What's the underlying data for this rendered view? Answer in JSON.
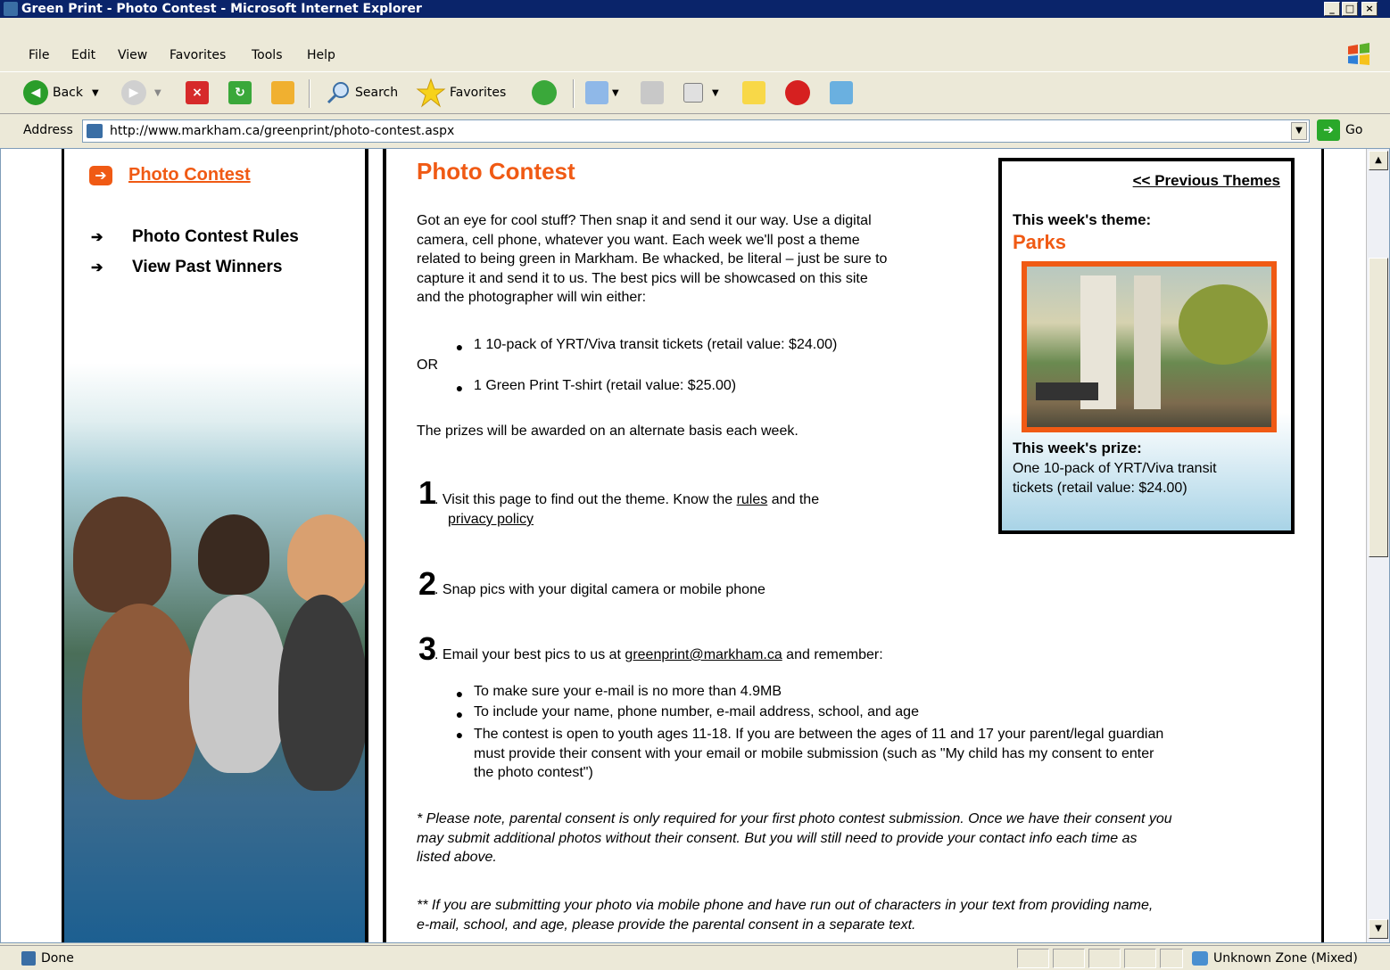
{
  "window": {
    "title": "Green Print - Photo Contest - Microsoft Internet Explorer"
  },
  "menu": [
    "File",
    "Edit",
    "View",
    "Favorites",
    "Tools",
    "Help"
  ],
  "toolbar": {
    "back": "Back",
    "search": "Search",
    "favorites": "Favorites"
  },
  "address": {
    "label": "Address",
    "url": "http://www.markham.ca/greenprint/photo-contest.aspx",
    "go": "Go"
  },
  "nav": {
    "current": "Photo Contest",
    "items": [
      "Photo Contest Rules",
      "View Past Winners"
    ]
  },
  "main": {
    "title": "Photo Contest",
    "intro_lines": [
      "Got an eye for cool stuff? Then snap it and send it our way. Use a digital",
      "camera, cell phone, whatever you want. Each week we'll post a theme",
      "related to being green in Markham. Be whacked, be literal – just be sure to",
      "capture it and send it to us. The best pics will be showcased on this site",
      "and the photographer will win either:"
    ],
    "prize_option_1": "1 10-pack of YRT/Viva transit tickets (retail value: $24.00)",
    "or_text": "OR",
    "prize_option_2": "1 Green Print T-shirt (retail value: $25.00)",
    "alternate_note": "The prizes will be awarded on an alternate basis each week.",
    "step1": {
      "num": "1",
      "text_before": ". Visit this page to find out the theme. Know the ",
      "rules_link": "rules",
      "text_after": " and the",
      "privacy_link": "privacy policy"
    },
    "step2": {
      "num": "2",
      "text": ". Snap pics with your digital camera or mobile phone"
    },
    "step3": {
      "num": "3",
      "text_before": ". Email your best pics to us at ",
      "email_link": "greenprint@markham.ca",
      "text_after": " and remember:"
    },
    "remember": [
      "To make sure your e-mail is no more than 4.9MB",
      "To include your name, phone number, e-mail address, school, and age"
    ],
    "age_rule_lines": [
      "The contest is open to youth ages 11-18. If you are between the ages of 11 and 17 your parent/legal guardian",
      "must provide their consent with your email or mobile submission (such as \"My child has my consent to enter",
      "the photo contest\")"
    ],
    "note1_lines": [
      "* Please note, parental consent is only required for your first photo contest submission. Once we have their consent you",
      "may submit additional photos without their consent. But you will still need to provide your contact info each time as",
      "listed above."
    ],
    "note2_lines": [
      "** If you are submitting your photo via mobile phone and have run out of characters in your text from providing name,",
      "e-mail, school, and age, please provide the parental consent in a separate text."
    ]
  },
  "theme_box": {
    "previous": "<< Previous Themes",
    "theme_label": "This week's theme:",
    "theme_value": "Parks",
    "prize_label": "This week's prize:",
    "prize_lines": [
      "One 10-pack of YRT/Viva transit",
      "tickets (retail value: $24.00)"
    ]
  },
  "status": {
    "text": "Done",
    "zone": "Unknown Zone (Mixed)"
  },
  "colors": {
    "accent": "#f05a14",
    "titlebar": "#0a246a"
  }
}
